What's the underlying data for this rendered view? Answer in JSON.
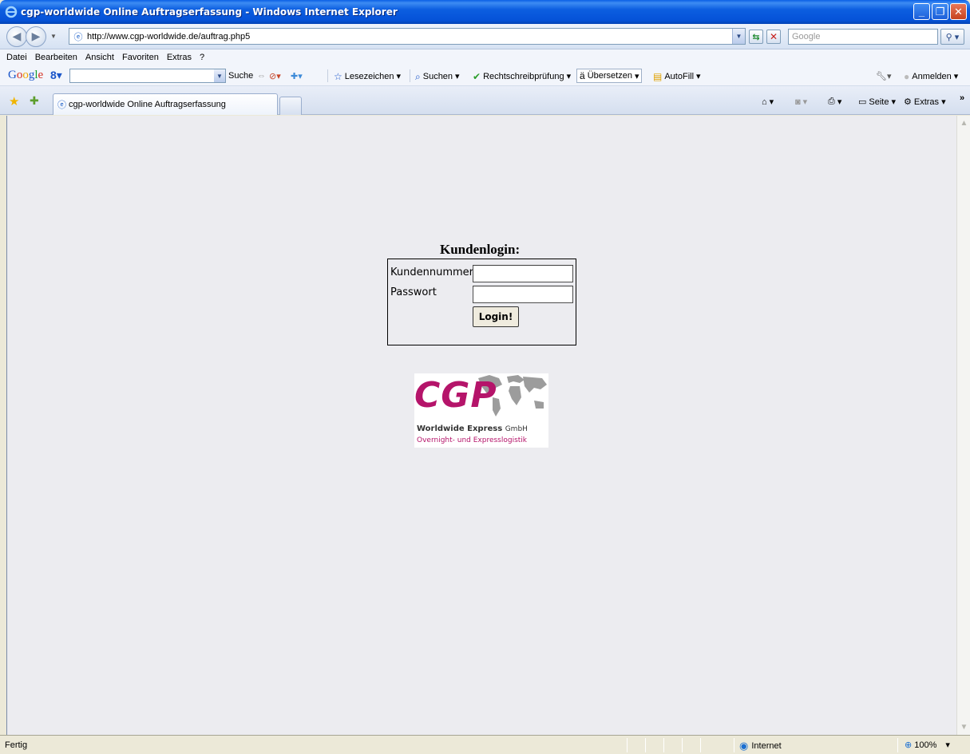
{
  "window": {
    "title": "cgp-worldwide Online Auftragserfassung - Windows Internet Explorer",
    "minimize": "_",
    "restore": "❐",
    "close": "✕"
  },
  "address_bar": {
    "url": "http://www.cgp-worldwide.de/auftrag.php5",
    "search_placeholder": "Google"
  },
  "menu": [
    "Datei",
    "Bearbeiten",
    "Ansicht",
    "Favoriten",
    "Extras",
    "?"
  ],
  "google_toolbar": {
    "logo": "Google",
    "items": {
      "suche": "Suche",
      "lesezeichen": "Lesezeichen",
      "suchen": "Suchen",
      "rechtschreib": "Rechtschreibprüfung",
      "uebersetzen": "Übersetzen",
      "autofill": "AutoFill",
      "anmelden": "Anmelden"
    }
  },
  "tabs": [
    {
      "label": "cgp-worldwide Online Auftragserfassung"
    }
  ],
  "command_bar": {
    "seite": "Seite",
    "extras": "Extras"
  },
  "page": {
    "heading": "Kundenlogin:",
    "customer_number_label": "Kundennummer",
    "customer_number_value": "",
    "password_label": "Passwort",
    "password_value": "",
    "login_button": "Login!",
    "logo": {
      "brand": "CGP",
      "company": "Worldwide Express",
      "company_suffix": "GmbH",
      "tagline": "Overnight- und Expresslogistik",
      "brand_color": "#b5146a"
    }
  },
  "status_bar": {
    "status": "Fertig",
    "zone": "Internet",
    "zoom": "100%"
  }
}
